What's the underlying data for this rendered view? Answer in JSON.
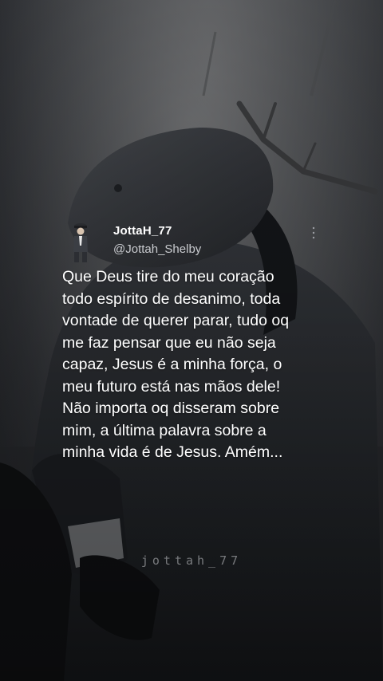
{
  "tweet": {
    "display_name": "JottaH_77",
    "handle": "@Jottah_Shelby",
    "text": "Que Deus tire do meu coração\ntodo espírito de desanimo, toda\nvontade de querer parar, tudo oq\nme faz pensar que eu não seja\ncapaz, Jesus é a minha força, o\nmeu futuro está nas mãos dele!\nNão importa oq disseram sobre\nmim, a última palavra sobre a\nminha vida é de Jesus. Amém...",
    "more_icon": "more-vertical-icon",
    "avatar_icon": "avatar-figure-icon"
  },
  "watermark": "jottah_77",
  "colors": {
    "text": "#ffffff",
    "handle": "#c9cbcf",
    "background": "#3a3c40"
  }
}
